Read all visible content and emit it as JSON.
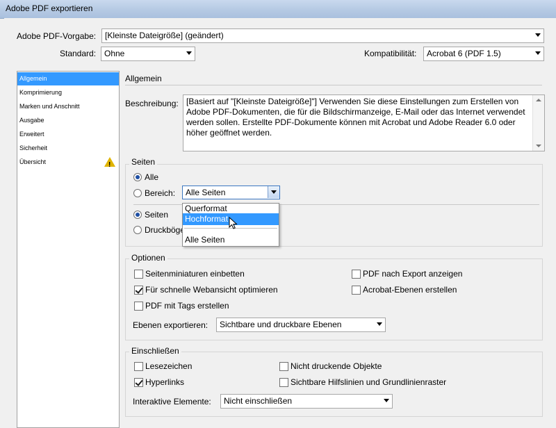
{
  "window": {
    "title": "Adobe PDF exportieren"
  },
  "preset": {
    "label": "Adobe PDF-Vorgabe:",
    "value": "[Kleinste Dateigröße] (geändert)"
  },
  "standard": {
    "label": "Standard:",
    "value": "Ohne"
  },
  "compat": {
    "label": "Kompatibilität:",
    "value": "Acrobat 6 (PDF 1.5)"
  },
  "sidebar": {
    "items": [
      {
        "label": "Allgemein"
      },
      {
        "label": "Komprimierung"
      },
      {
        "label": "Marken und Anschnitt"
      },
      {
        "label": "Ausgabe"
      },
      {
        "label": "Erweitert"
      },
      {
        "label": "Sicherheit"
      },
      {
        "label": "Übersicht"
      }
    ],
    "warning_icon": "warning-icon"
  },
  "panel": {
    "title": "Allgemein"
  },
  "description": {
    "label": "Beschreibung:",
    "text": "[Basiert auf \"[Kleinste Dateigröße]\"] Verwenden Sie diese Einstellungen zum Erstellen von Adobe PDF-Dokumenten, die für die Bildschirmanzeige, E-Mail oder das Internet verwendet werden sollen. Erstellte PDF-Dokumente können mit Acrobat und Adobe Reader 6.0 oder höher geöffnet werden."
  },
  "pages": {
    "title": "Seiten",
    "all": "Alle",
    "range": "Bereich:",
    "range_value": "Alle Seiten",
    "pages_opt": "Seiten",
    "spreads_opt": "Druckbögen"
  },
  "dropdown": {
    "items": [
      "Querformat",
      "Hochformat",
      "Alle Seiten"
    ]
  },
  "options": {
    "title": "Optionen",
    "thumbs": "Seitenminiaturen einbetten",
    "fastweb": "Für schnelle Webansicht optimieren",
    "tags": "PDF mit Tags erstellen",
    "view_after": "PDF nach Export anzeigen",
    "acrobat_layers": "Acrobat-Ebenen erstellen",
    "export_layers_label": "Ebenen exportieren:",
    "export_layers_value": "Sichtbare und druckbare Ebenen"
  },
  "include": {
    "title": "Einschließen",
    "bookmarks": "Lesezeichen",
    "hyperlinks": "Hyperlinks",
    "nonprint": "Nicht druckende Objekte",
    "guides": "Sichtbare Hilfslinien und Grundlinienraster",
    "interactive_label": "Interaktive Elemente:",
    "interactive_value": "Nicht einschließen"
  },
  "colors": {
    "accent": "#3399ff",
    "warning": "#e0b400"
  }
}
